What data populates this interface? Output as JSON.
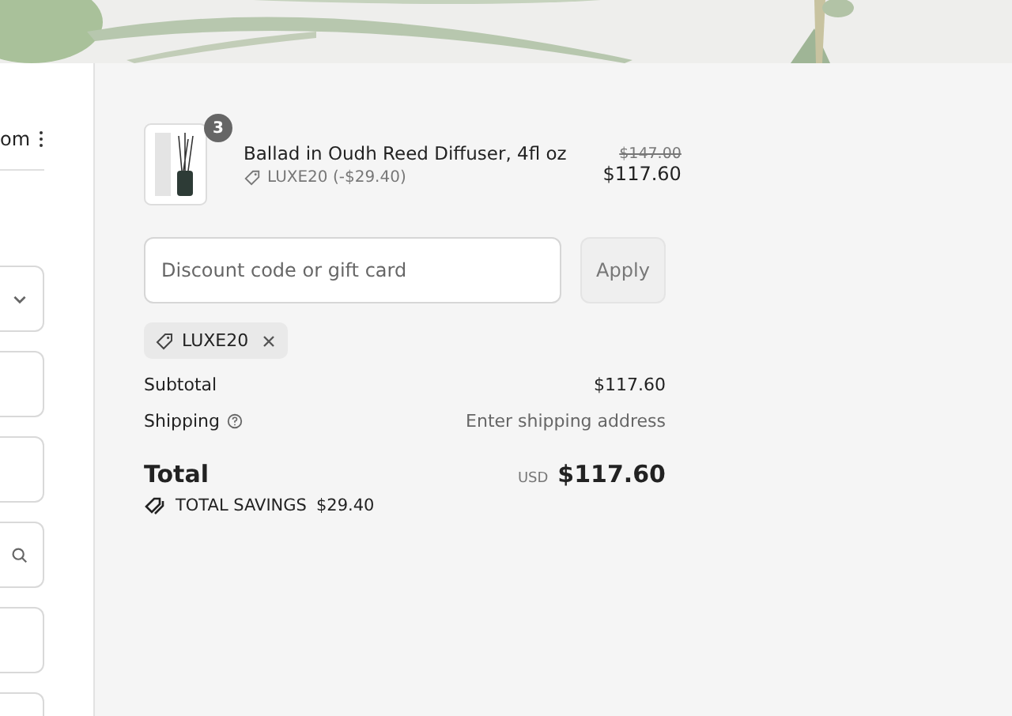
{
  "contact": {
    "text": "om"
  },
  "form_fields": [
    {
      "kind": "select"
    },
    {
      "kind": "text"
    },
    {
      "kind": "text"
    },
    {
      "kind": "search"
    },
    {
      "kind": "text"
    },
    {
      "kind": "text"
    }
  ],
  "summary": {
    "items": [
      {
        "name": "Ballad in Oudh Reed Diffuser, 4fl oz",
        "quantity": "3",
        "discount": "LUXE20 (-$29.40)",
        "original_price": "$147.00",
        "price": "$117.60"
      }
    ],
    "discount_field": {
      "placeholder": "Discount code or gift card"
    },
    "apply_button": {
      "label": "Apply",
      "disabled": true
    },
    "applied_codes": [
      "LUXE20"
    ],
    "subtotal": {
      "label": "Subtotal",
      "value": "$117.60"
    },
    "shipping": {
      "label": "Shipping",
      "value": "Enter shipping address"
    },
    "total": {
      "label": "Total",
      "currency": "USD",
      "value": "$117.60"
    },
    "savings": {
      "label": "TOTAL SAVINGS",
      "value": "$29.40"
    }
  }
}
